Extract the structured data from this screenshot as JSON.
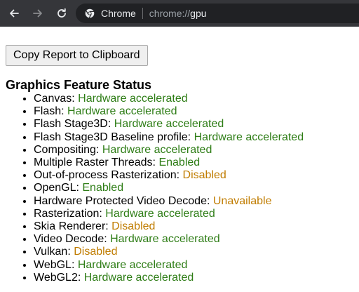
{
  "toolbar": {
    "back_icon": "back-arrow-icon",
    "forward_icon": "forward-arrow-icon",
    "reload_icon": "reload-icon",
    "site_label": "Chrome",
    "url_scheme": "chrome://",
    "url_host": "gpu"
  },
  "page": {
    "copy_button_label": "Copy Report to Clipboard",
    "section_title": "Graphics Feature Status",
    "features": [
      {
        "name": "Canvas: ",
        "status": "Hardware accelerated",
        "state": "enabled"
      },
      {
        "name": "Flash: ",
        "status": "Hardware accelerated",
        "state": "enabled"
      },
      {
        "name": "Flash Stage3D: ",
        "status": "Hardware accelerated",
        "state": "enabled"
      },
      {
        "name": "Flash Stage3D Baseline profile: ",
        "status": "Hardware accelerated",
        "state": "enabled"
      },
      {
        "name": "Compositing: ",
        "status": "Hardware accelerated",
        "state": "enabled"
      },
      {
        "name": "Multiple Raster Threads: ",
        "status": "Enabled",
        "state": "enabled"
      },
      {
        "name": "Out-of-process Rasterization: ",
        "status": "Disabled",
        "state": "disabled"
      },
      {
        "name": "OpenGL: ",
        "status": "Enabled",
        "state": "enabled"
      },
      {
        "name": "Hardware Protected Video Decode: ",
        "status": "Unavailable",
        "state": "disabled"
      },
      {
        "name": "Rasterization: ",
        "status": "Hardware accelerated",
        "state": "enabled"
      },
      {
        "name": "Skia Renderer: ",
        "status": "Disabled",
        "state": "disabled"
      },
      {
        "name": "Video Decode: ",
        "status": "Hardware accelerated",
        "state": "enabled"
      },
      {
        "name": "Vulkan: ",
        "status": "Disabled",
        "state": "disabled"
      },
      {
        "name": "WebGL: ",
        "status": "Hardware accelerated",
        "state": "enabled"
      },
      {
        "name": "WebGL2: ",
        "status": "Hardware accelerated",
        "state": "enabled"
      }
    ]
  },
  "colors": {
    "toolbar_bg": "#35363a",
    "omnibox_bg": "#202124",
    "enabled_green": "#2e7d16",
    "disabled_orange": "#c07c00"
  }
}
